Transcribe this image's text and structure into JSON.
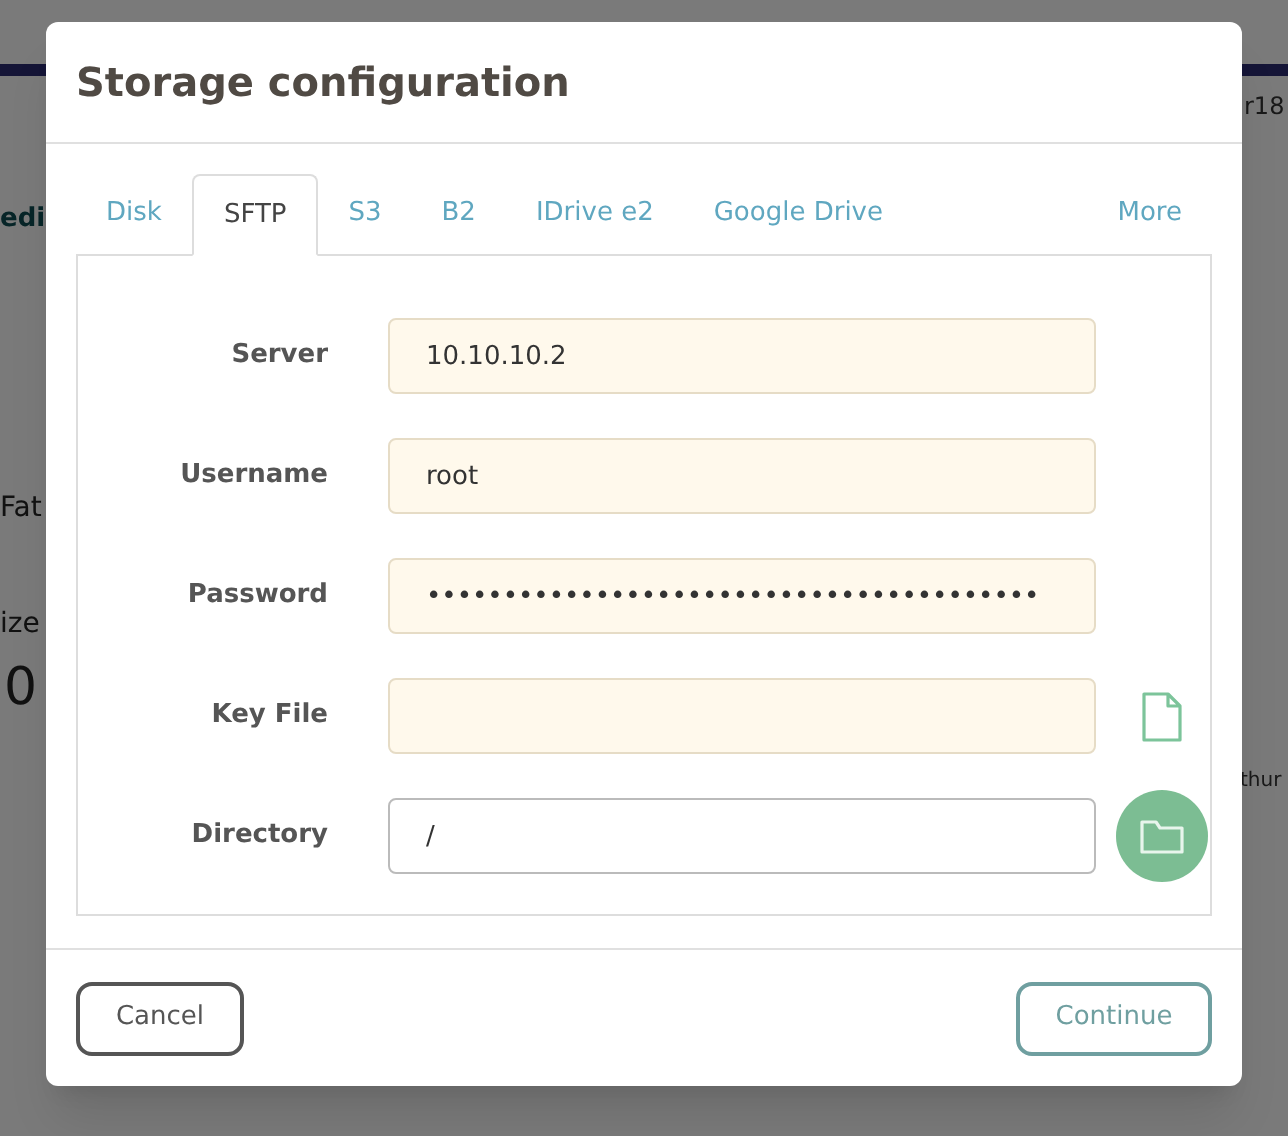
{
  "background": {
    "texts": [
      {
        "text": "edi",
        "kind": "link"
      },
      {
        "text": "Fat",
        "kind": "plain"
      },
      {
        "text": "ize",
        "kind": "plain"
      },
      {
        "text": "0",
        "kind": "big"
      },
      {
        "text": "r18",
        "kind": "plain"
      },
      {
        "text": "thur",
        "kind": "plain"
      }
    ]
  },
  "dialog": {
    "title": "Storage configuration",
    "tabs": [
      {
        "label": "Disk",
        "selected": false
      },
      {
        "label": "SFTP",
        "selected": true
      },
      {
        "label": "S3",
        "selected": false
      },
      {
        "label": "B2",
        "selected": false
      },
      {
        "label": "IDrive e2",
        "selected": false
      },
      {
        "label": "Google Drive",
        "selected": false
      },
      {
        "label": "More",
        "selected": false
      }
    ],
    "fields": [
      {
        "label": "Server",
        "value": "10.10.10.2",
        "focused": false
      },
      {
        "label": "Username",
        "value": "root",
        "focused": false
      },
      {
        "label": "Password",
        "value": "••••••••••••••••••••••••••••••••••••••••",
        "focused": false
      },
      {
        "label": "Key File",
        "focused": false,
        "kind": "file"
      },
      {
        "label": "Directory",
        "value": "/",
        "focused": true,
        "kind": "folder"
      }
    ],
    "buttons": [
      {
        "label": "Cancel",
        "kind": "cancel"
      },
      {
        "label": "Continue",
        "kind": "primary"
      }
    ]
  }
}
